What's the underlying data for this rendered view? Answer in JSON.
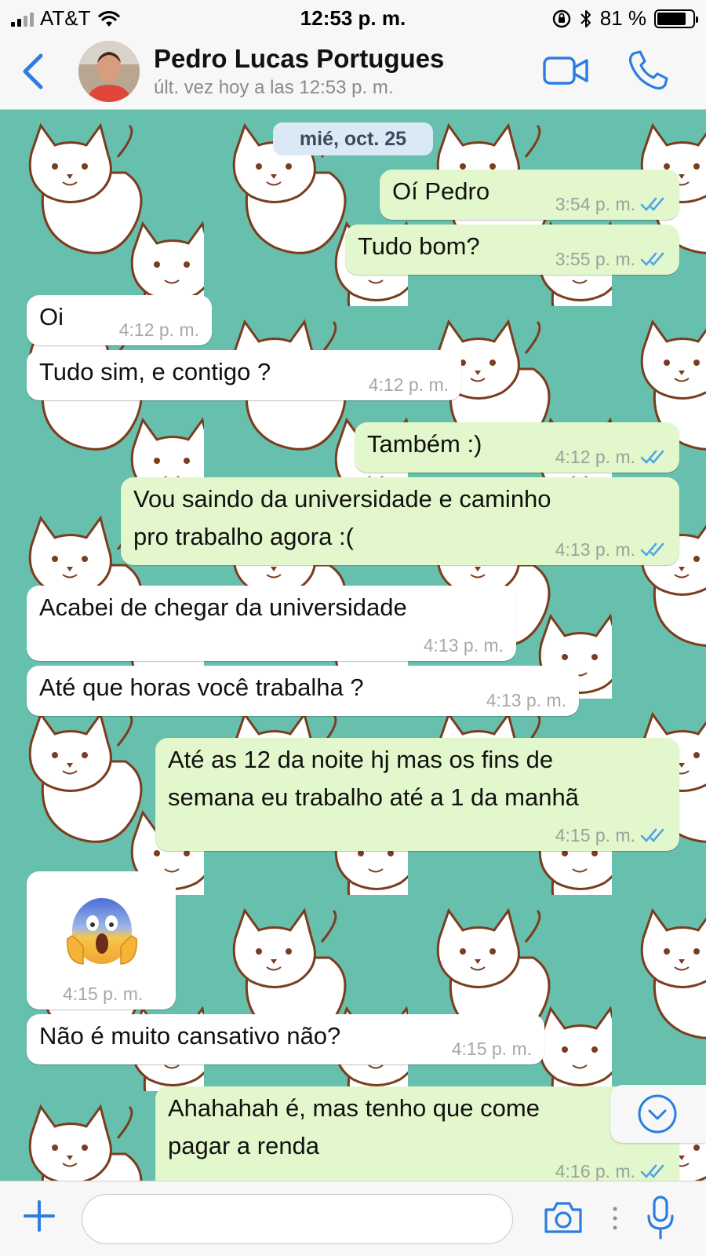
{
  "status_bar": {
    "carrier": "AT&T",
    "time": "12:53 p. m.",
    "battery": "81 %",
    "battery_level": 0.81
  },
  "header": {
    "back_icon": "chevron-left-icon",
    "contact_name": "Pedro Lucas Portugues",
    "last_seen": "últ. vez hoy a las 12:53 p. m.",
    "video_icon": "video-camera-icon",
    "call_icon": "phone-icon"
  },
  "chat": {
    "date_badge": "mié, oct. 25",
    "colors": {
      "wallpaper": "#67bfae",
      "outgoing": "#e2f7cb",
      "incoming": "#ffffff",
      "read_ticks": "#4fa6e6"
    },
    "messages": [
      {
        "dir": "out",
        "text": "Oí Pedro",
        "time": "3:54 p. m."
      },
      {
        "dir": "out",
        "text": "Tudo bom?",
        "time": "3:55 p. m."
      },
      {
        "dir": "in",
        "text": "Oi",
        "time": "4:12 p. m."
      },
      {
        "dir": "in",
        "text": "Tudo sim, e contigo ?",
        "time": "4:12 p. m."
      },
      {
        "dir": "out",
        "text": "Também :)",
        "time": "4:12 p. m."
      },
      {
        "dir": "out",
        "text": "Vou saindo da universidade e caminho",
        "text2": "pro trabalho agora :(",
        "time": "4:13 p. m."
      },
      {
        "dir": "in",
        "text": "Acabei de chegar da universidade",
        "time": "4:13 p. m."
      },
      {
        "dir": "in",
        "text": "Até que horas você trabalha ?",
        "time": "4:13 p. m."
      },
      {
        "dir": "out",
        "text": "Até as 12 da noite hj mas os fins de",
        "text2": "semana eu trabalho até a 1 da manhã",
        "time": "4:15 p. m."
      },
      {
        "dir": "in",
        "emoji": "face-screaming-in-fear-emoji",
        "time": "4:15 p. m."
      },
      {
        "dir": "in",
        "text": "Não é muito cansativo não?",
        "time": "4:15 p. m."
      },
      {
        "dir": "out",
        "text": "Ahahahah é, mas tenho que come",
        "text2": "pagar a renda",
        "time": "4:16 p. m."
      }
    ],
    "scroll_down_icon": "chevron-down-circle-icon"
  },
  "input_bar": {
    "plus_icon": "plus-icon",
    "message_value": "",
    "camera_icon": "camera-icon",
    "mic_icon": "microphone-icon"
  }
}
